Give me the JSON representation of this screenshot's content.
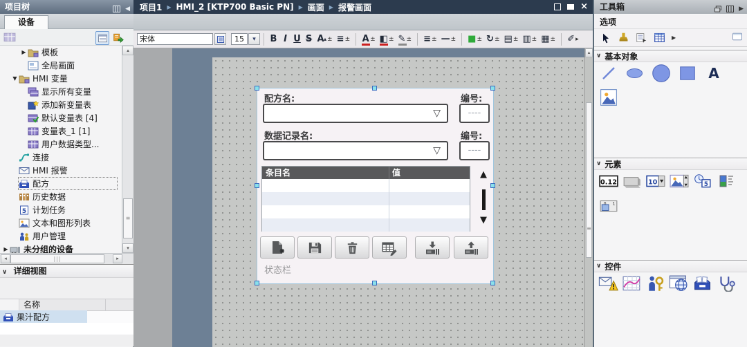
{
  "titlebar": {
    "project_tree_title": "项目树",
    "toolbox_title": "工具箱",
    "breadcrumb": [
      "项目1",
      "HMI_2 [KTP700 Basic PN]",
      "画面",
      "报警画面"
    ]
  },
  "project_tree": {
    "tab_label": "设备",
    "items": [
      {
        "label": "模板",
        "icon": "t-folder",
        "level": 2,
        "arrow": "right"
      },
      {
        "label": "全局画面",
        "icon": "t-screen",
        "level": 2
      },
      {
        "label": "HMI 变量",
        "icon": "t-folder",
        "level": 1,
        "arrow": "down"
      },
      {
        "label": "显示所有变量",
        "icon": "t-table2",
        "level": 2
      },
      {
        "label": "添加新变量表",
        "icon": "t-tableadd",
        "level": 2
      },
      {
        "label": "默认变量表 [4]",
        "icon": "t-tablecheck",
        "level": 2
      },
      {
        "label": "变量表_1 [1]",
        "icon": "t-table",
        "level": 2
      },
      {
        "label": "用户数据类型...",
        "icon": "t-table",
        "level": 2
      },
      {
        "label": "连接",
        "icon": "t-conn",
        "level": 1
      },
      {
        "label": "HMI 报警",
        "icon": "t-mail",
        "level": 1
      },
      {
        "label": "配方",
        "icon": "t-recipe",
        "level": 1,
        "selected": true
      },
      {
        "label": "历史数据",
        "icon": "t-hist",
        "level": 1
      },
      {
        "label": "计划任务",
        "icon": "t-sched",
        "level": 1
      },
      {
        "label": "文本和图形列表",
        "icon": "t-textlist",
        "level": 1
      },
      {
        "label": "用户管理",
        "icon": "t-users",
        "level": 1
      },
      {
        "label": "未分组的设备",
        "icon": "t-device",
        "level": 0,
        "arrow": "right",
        "bold": true
      }
    ]
  },
  "detail_view": {
    "title": "详细视图",
    "name_header": "名称",
    "rows": [
      {
        "label": "果汁配方",
        "icon": "t-recipe"
      }
    ]
  },
  "format_toolbar": {
    "font_name": "宋体",
    "font_size": "15",
    "buttons": [
      {
        "name": "bold",
        "glyph": "B"
      },
      {
        "name": "italic",
        "glyph": "I",
        "cls": "it"
      },
      {
        "name": "underline",
        "glyph": "U",
        "cls": "ul"
      },
      {
        "name": "strikethrough",
        "glyph": "S",
        "cls": "st"
      },
      {
        "name": "font-size",
        "glyph": "A",
        "sup": "▴",
        "pm": true
      },
      {
        "name": "alignment",
        "glyph": "≡",
        "pm": true
      },
      {
        "sep": true
      },
      {
        "name": "font-color",
        "glyph": "A",
        "bar": "#cc2020",
        "pm": true
      },
      {
        "name": "background-color",
        "glyph": "◧",
        "bar": "#cc2020",
        "pm": true
      },
      {
        "name": "border-color",
        "glyph": "✎",
        "bar": "#8a8a8a",
        "pm": true
      },
      {
        "sep": true
      },
      {
        "name": "line-style",
        "glyph": "≡",
        "pm": true
      },
      {
        "name": "line-width",
        "glyph": "—",
        "pm": true
      },
      {
        "sep": true
      },
      {
        "name": "fill-color",
        "glyph": "■",
        "color": "#2faa3a",
        "pm": true
      },
      {
        "name": "rotation",
        "glyph": "↻",
        "pm": true
      },
      {
        "name": "arrange",
        "glyph": "▤",
        "pm": true
      },
      {
        "name": "align-objects",
        "glyph": "▥",
        "pm": true
      },
      {
        "name": "distribute",
        "glyph": "▦",
        "pm": true
      },
      {
        "sep": true
      },
      {
        "name": "format-painter",
        "glyph": "✐",
        "more": "▸"
      }
    ]
  },
  "canvas": {
    "recipe_view": {
      "recipe_name_label": "配方名:",
      "recipe_number_label": "编号:",
      "record_name_label": "数据记录名:",
      "record_number_label": "编号:",
      "number_value": "----",
      "table": {
        "columns": [
          "条目名",
          "值"
        ],
        "row_count": 4,
        "alt_row_color": "#e9edf5"
      },
      "buttons": [
        {
          "name": "new-data-record",
          "icon": "wb-new"
        },
        {
          "name": "save-data-record",
          "icon": "wb-save"
        },
        {
          "name": "delete-data-record",
          "icon": "wb-del"
        },
        {
          "name": "rename-data-record",
          "icon": "wb-edit"
        },
        {
          "name": "download-to-plc",
          "icon": "wb-down"
        },
        {
          "name": "upload-from-plc",
          "icon": "wb-up"
        }
      ],
      "status_bar": "状态栏"
    }
  },
  "toolbox": {
    "options_label": "选项",
    "option_tools": [
      "cursor-tool",
      "stamp-tool",
      "softkey-tool",
      "table-tool"
    ],
    "sections": [
      {
        "label": "基本对象",
        "icons": [
          "line",
          "ellipse",
          "circle",
          "rectangle",
          "text-field",
          "graphic-view"
        ]
      },
      {
        "label": "元素",
        "icons": [
          "io-field",
          "button-el",
          "symbolic-io-field",
          "graphic-io-field",
          "date-time-field",
          "bar-el",
          "switch-el"
        ]
      },
      {
        "label": "控件",
        "icons": [
          "alarm-view",
          "trend-view",
          "user-view",
          "html-browser",
          "recipe-view-ctl",
          "sysdiag-view"
        ]
      }
    ]
  },
  "colors": {
    "titlebar_dark": "#2c3b4e",
    "canvas_gray": "#a8aaac",
    "canvas_band": "#6d8095",
    "screen_dotted": "#c6c8c6",
    "selection_handle": "#8ae0ea",
    "table_header": "#59595b",
    "basic_object_blue": "#7e96e4"
  }
}
